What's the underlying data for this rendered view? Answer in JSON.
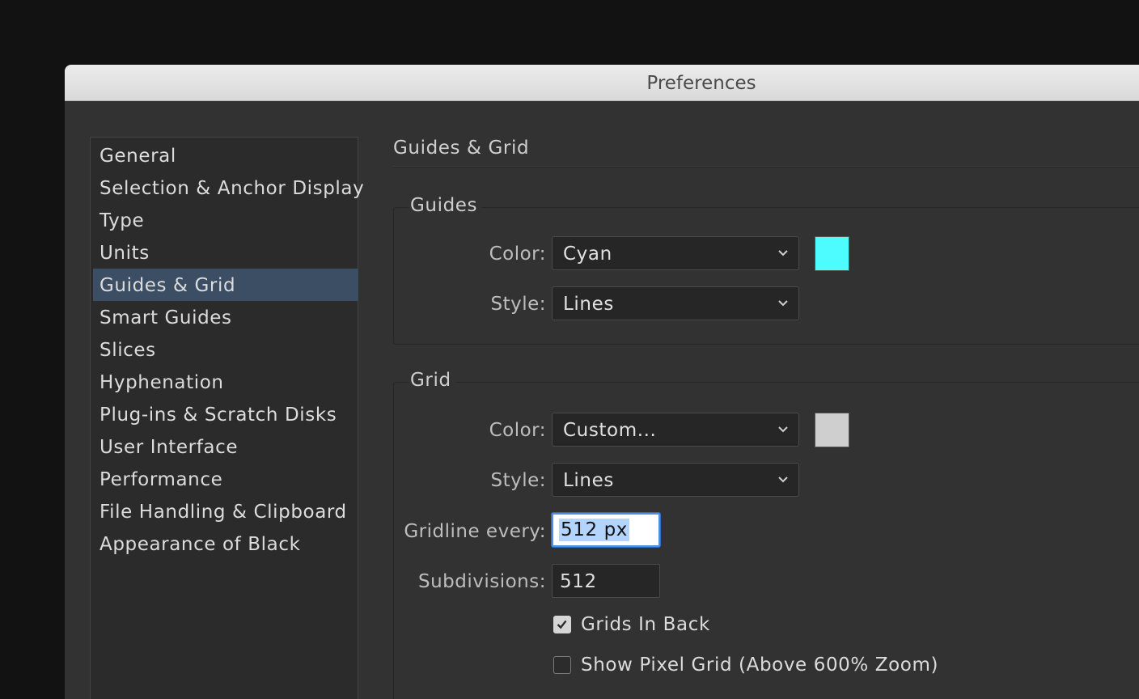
{
  "window": {
    "title": "Preferences"
  },
  "sidebar": {
    "items": [
      {
        "label": "General"
      },
      {
        "label": "Selection & Anchor Display"
      },
      {
        "label": "Type"
      },
      {
        "label": "Units"
      },
      {
        "label": "Guides & Grid",
        "selected": true
      },
      {
        "label": "Smart Guides"
      },
      {
        "label": "Slices"
      },
      {
        "label": "Hyphenation"
      },
      {
        "label": "Plug-ins & Scratch Disks"
      },
      {
        "label": "User Interface"
      },
      {
        "label": "Performance"
      },
      {
        "label": "File Handling & Clipboard"
      },
      {
        "label": "Appearance of Black"
      }
    ]
  },
  "main": {
    "heading": "Guides & Grid",
    "guides": {
      "legend": "Guides",
      "color_label": "Color:",
      "color_value": "Cyan",
      "color_swatch": "#4dfcff",
      "style_label": "Style:",
      "style_value": "Lines"
    },
    "grid": {
      "legend": "Grid",
      "color_label": "Color:",
      "color_value": "Custom...",
      "color_swatch": "#cfcfcf",
      "style_label": "Style:",
      "style_value": "Lines",
      "gridline_label": "Gridline every:",
      "gridline_value": "512 px",
      "subdivisions_label": "Subdivisions:",
      "subdivisions_value": "512",
      "grids_in_back_label": "Grids In Back",
      "grids_in_back_checked": true,
      "pixel_grid_label": "Show Pixel Grid (Above 600% Zoom)",
      "pixel_grid_checked": false
    }
  },
  "icons": {
    "dropdown": "chevron-down-icon",
    "checkmark": "checkmark-icon"
  }
}
